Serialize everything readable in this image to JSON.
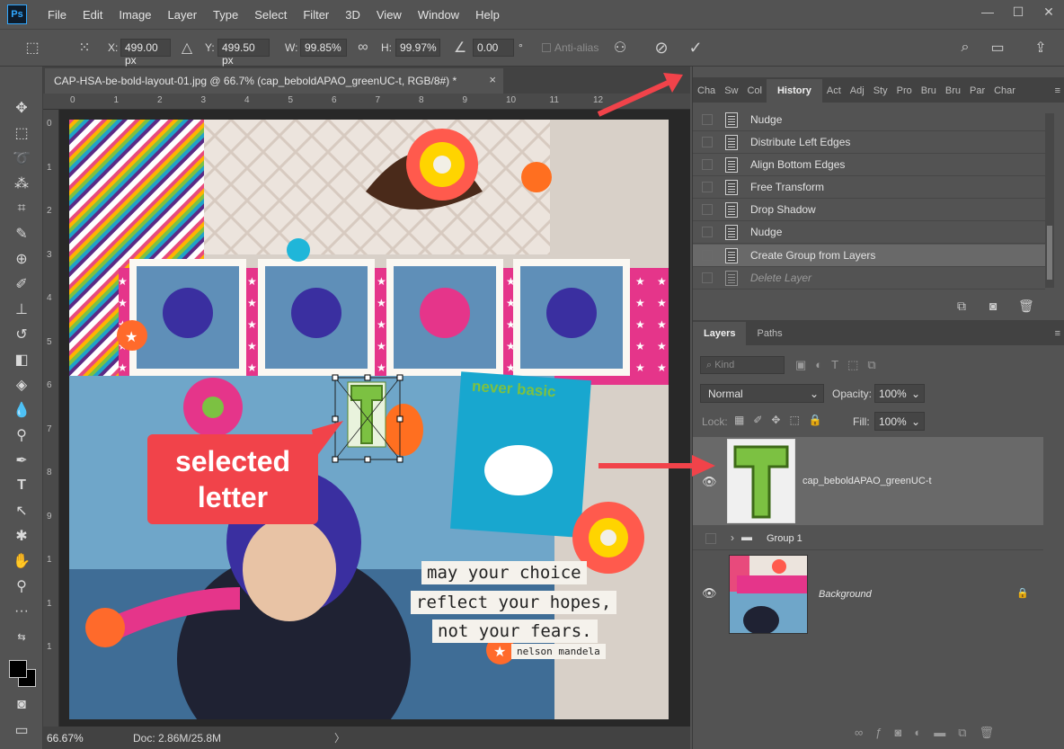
{
  "app": {
    "logo": "Ps",
    "menu": [
      "File",
      "Edit",
      "Image",
      "Layer",
      "Type",
      "Select",
      "Filter",
      "3D",
      "View",
      "Window",
      "Help"
    ],
    "window_controls": [
      "minimize",
      "maximize",
      "close"
    ]
  },
  "options_bar": {
    "x_label": "X:",
    "x_value": "499.00 px",
    "y_label": "Y:",
    "y_value": "499.50 px",
    "w_label": "W:",
    "w_value": "99.85%",
    "h_label": "H:",
    "h_value": "99.97%",
    "angle_value": "0.00",
    "angle_unit": "°",
    "antialias_label": "Anti-alias"
  },
  "document": {
    "tab_title": "CAP-HSA-be-bold-layout-01.jpg @ 66.7% (cap_beboldAPAO_greenUC-t, RGB/8#) *",
    "close": "×",
    "ruler_top": [
      "0",
      "1",
      "2",
      "3",
      "4",
      "5",
      "6",
      "7",
      "8",
      "9",
      "10",
      "11",
      "12"
    ],
    "ruler_left": [
      "0",
      "1",
      "2",
      "3",
      "4",
      "5",
      "6",
      "7",
      "8",
      "9",
      "1",
      "1",
      "1"
    ],
    "zoom": "66.67%",
    "doc_info": "Doc: 2.86M/25.8M",
    "status_arrow": "〉"
  },
  "canvas": {
    "annotation": {
      "line1": "selected",
      "line2": "letter"
    },
    "never_basic": "never basic",
    "selected_letter": "T",
    "quote": [
      "may your choice",
      "reflect your hopes,",
      "not your fears."
    ],
    "attribution": "nelson mandela"
  },
  "history_panel": {
    "tabs": [
      "Cha",
      "Sw",
      "Col",
      "History",
      "Act",
      "Adj",
      "Sty",
      "Pro",
      "Bru",
      "Bru",
      "Par",
      "Char"
    ],
    "active_tab": "History",
    "items": [
      {
        "label": "Nudge",
        "state": "normal"
      },
      {
        "label": "Distribute Left Edges",
        "state": "normal"
      },
      {
        "label": "Align Bottom Edges",
        "state": "normal"
      },
      {
        "label": "Free Transform",
        "state": "normal"
      },
      {
        "label": "Drop Shadow",
        "state": "normal"
      },
      {
        "label": "Nudge",
        "state": "normal"
      },
      {
        "label": "Create Group from Layers",
        "state": "selected"
      },
      {
        "label": "Delete Layer",
        "state": "undone"
      }
    ]
  },
  "layers_panel": {
    "tabs": [
      "Layers",
      "Paths"
    ],
    "kind_placeholder": "Kind",
    "blend_mode": "Normal",
    "opacity_label": "Opacity:",
    "opacity_value": "100%",
    "lock_label": "Lock:",
    "fill_label": "Fill:",
    "fill_value": "100%",
    "layers": [
      {
        "name": "cap_beboldAPAO_greenUC-t",
        "visible": true,
        "selected": true
      },
      {
        "name": "Group 1",
        "visible": false,
        "selected": false
      },
      {
        "name": "Background",
        "visible": true,
        "selected": false,
        "locked": true
      }
    ]
  },
  "colors": {
    "accent_red": "#f1434a",
    "letter_green": "#7cc142",
    "ps_blue": "#31a8ff",
    "panel_bg": "#535353"
  }
}
